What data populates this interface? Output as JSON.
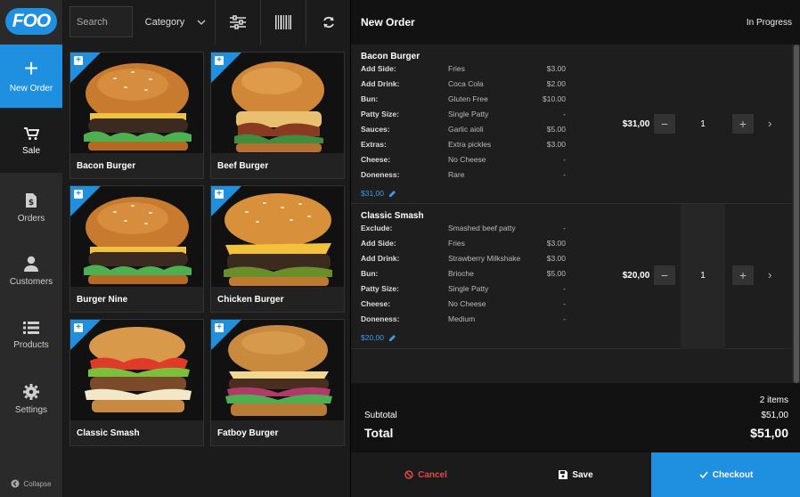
{
  "brand": {
    "logo_text": "FOO",
    "accent": "#1f8fe0",
    "danger": "#e04a4a"
  },
  "sidebar": {
    "items": [
      {
        "label": "New Order",
        "icon": "plus-icon"
      },
      {
        "label": "Sale",
        "icon": "cart-icon"
      },
      {
        "label": "Orders",
        "icon": "file-dollar-icon"
      },
      {
        "label": "Customers",
        "icon": "user-icon"
      },
      {
        "label": "Products",
        "icon": "list-icon"
      },
      {
        "label": "Settings",
        "icon": "gear-icon"
      }
    ],
    "collapse_label": "Collapse"
  },
  "toolbar": {
    "search_placeholder": "Search",
    "category_label": "Category"
  },
  "products": [
    {
      "name": "Bacon Burger"
    },
    {
      "name": "Beef Burger"
    },
    {
      "name": "Burger Nine"
    },
    {
      "name": "Chicken Burger"
    },
    {
      "name": "Classic Smash"
    },
    {
      "name": "Fatboy Burger"
    }
  ],
  "order": {
    "title": "New Order",
    "status": "In Progress",
    "items": [
      {
        "name": "Bacon Burger",
        "options": [
          {
            "key": "Add Side:",
            "value": "Fries",
            "price": "$3.00"
          },
          {
            "key": "Add Drink:",
            "value": "Coca Cola",
            "price": "$2.00"
          },
          {
            "key": "Bun:",
            "value": "Gluten Free",
            "price": "$10.00"
          },
          {
            "key": "Patty Size:",
            "value": "Single Patty",
            "price": "-"
          },
          {
            "key": "Sauces:",
            "value": "Garlic aioli",
            "price": "$5.00"
          },
          {
            "key": "Extras:",
            "value": "Extra pickles",
            "price": "$3.00"
          },
          {
            "key": "Cheese:",
            "value": "No Cheese",
            "price": "-"
          },
          {
            "key": "Doneness:",
            "value": "Rare",
            "price": "-"
          }
        ],
        "subtotal": "$31,00",
        "price": "$31,00",
        "qty": "1"
      },
      {
        "name": "Classic Smash",
        "options": [
          {
            "key": "Exclude:",
            "value": "Smashed beef patty",
            "price": "-"
          },
          {
            "key": "Add Side:",
            "value": "Fries",
            "price": "$3.00"
          },
          {
            "key": "Add Drink:",
            "value": "Strawberry Milkshake",
            "price": "$3.00"
          },
          {
            "key": "Bun:",
            "value": "Brioche",
            "price": "$5.00"
          },
          {
            "key": "Patty Size:",
            "value": "Single Patty",
            "price": "-"
          },
          {
            "key": "Cheese:",
            "value": "No Cheese",
            "price": "-"
          },
          {
            "key": "Doneness:",
            "value": "Medium",
            "price": "-"
          }
        ],
        "subtotal": "$20,00",
        "price": "$20,00",
        "qty": "1"
      }
    ],
    "items_count": "2 items",
    "subtotal_label": "Subtotal",
    "subtotal_value": "$51,00",
    "total_label": "Total",
    "total_value": "$51,00"
  },
  "actions": {
    "cancel": "Cancel",
    "save": "Save",
    "checkout": "Checkout"
  }
}
